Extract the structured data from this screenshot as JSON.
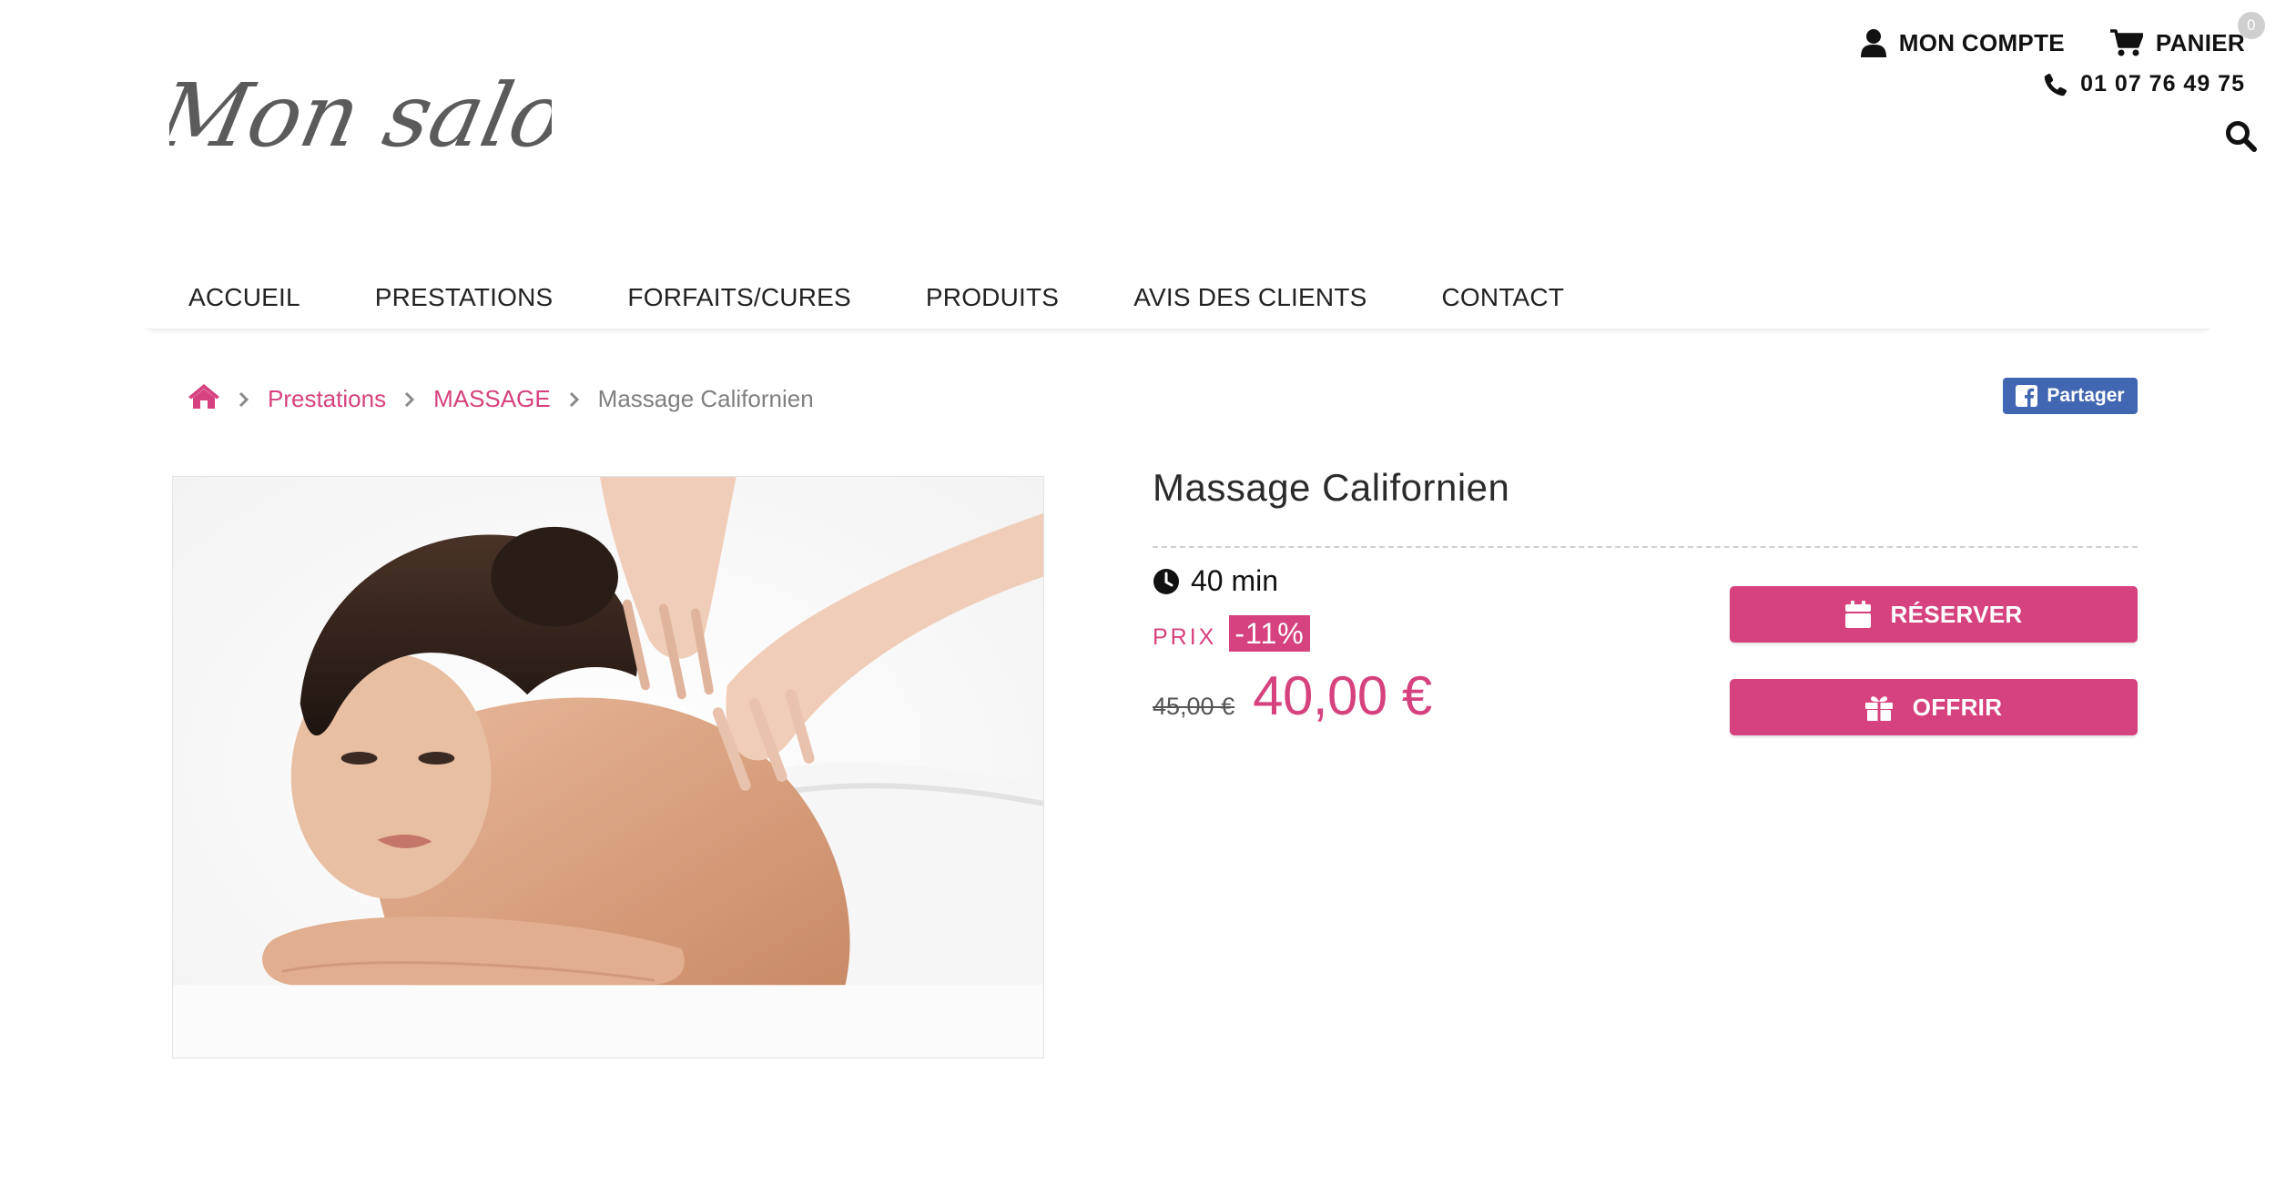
{
  "header": {
    "logo_text": "Mon salon",
    "account_label": "MON COMPTE",
    "cart_label": "PANIER",
    "cart_count": "0",
    "phone": "01 07 76 49 75"
  },
  "nav": {
    "items": [
      {
        "label": "ACCUEIL"
      },
      {
        "label": "PRESTATIONS"
      },
      {
        "label": "FORFAITS/CURES"
      },
      {
        "label": "PRODUITS"
      },
      {
        "label": "AVIS DES CLIENTS"
      },
      {
        "label": "CONTACT"
      }
    ]
  },
  "breadcrumb": {
    "items": [
      {
        "label": "Prestations"
      },
      {
        "label": "MASSAGE"
      }
    ],
    "current": "Massage Californien"
  },
  "share": {
    "label": "Partager"
  },
  "product": {
    "title": "Massage Californien",
    "duration": "40 min",
    "price_label": "PRIX",
    "discount": "-11%",
    "old_price": "45,00 €",
    "price": "40,00 €",
    "reserve_label": "RÉSERVER",
    "offer_label": "OFFRIR"
  },
  "colors": {
    "accent": "#d6427e",
    "facebook": "#4267b2",
    "text": "#2b2b2b"
  },
  "icons": [
    "user-icon",
    "cart-icon",
    "phone-icon",
    "search-icon",
    "home-icon",
    "chevron-right-icon",
    "facebook-icon",
    "clock-icon",
    "calendar-icon",
    "gift-icon"
  ]
}
